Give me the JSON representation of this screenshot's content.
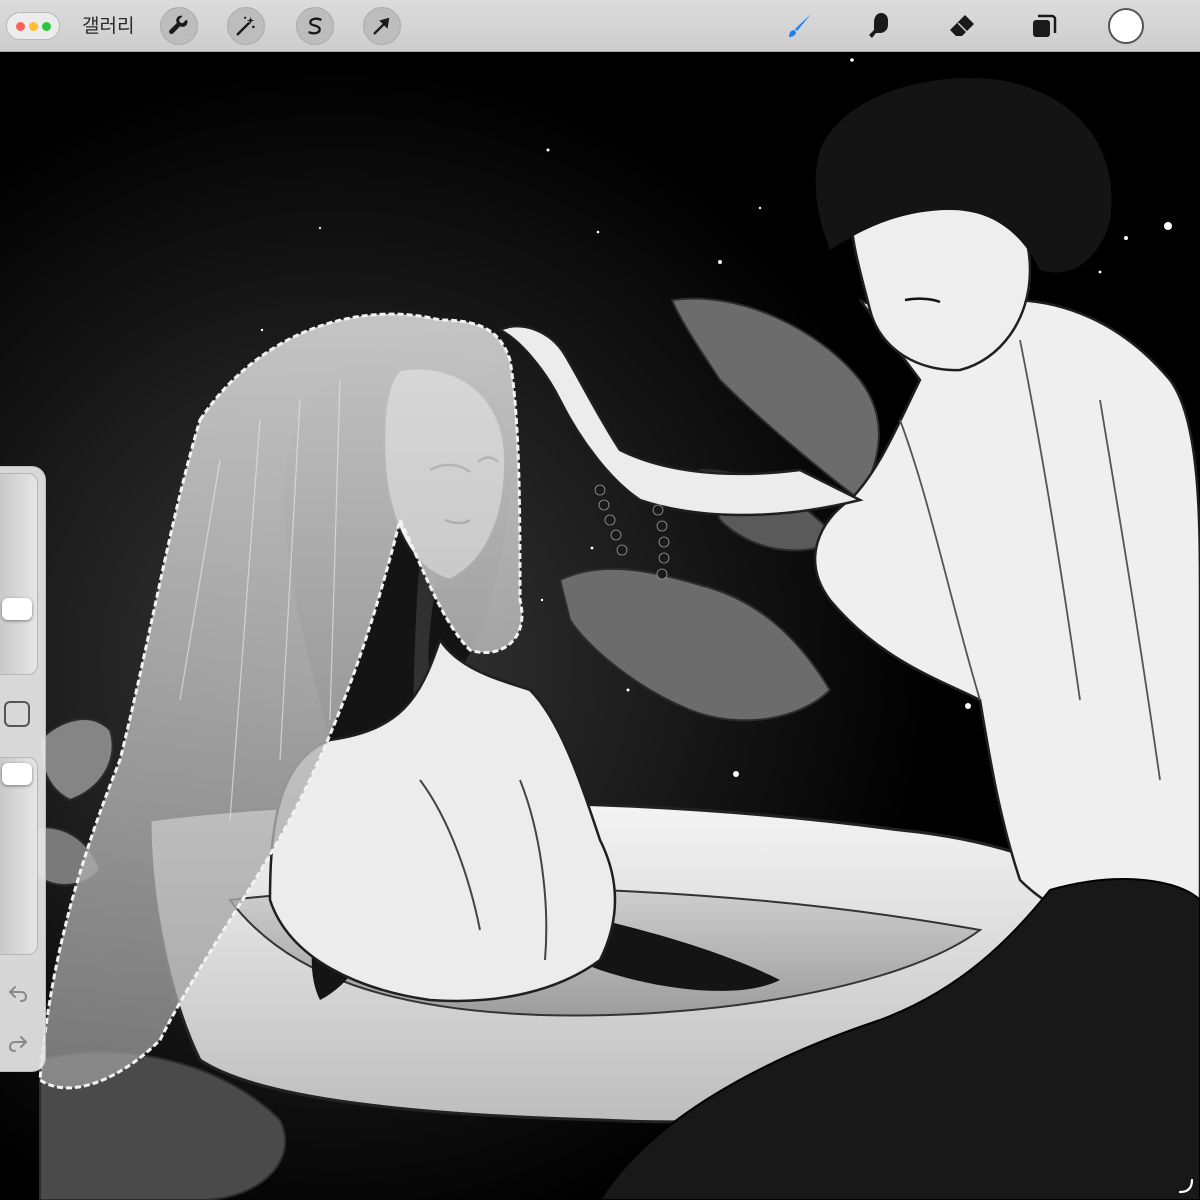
{
  "app": {
    "gallery_label": "갤러리"
  },
  "toolbar": {
    "left_tools": [
      {
        "name": "actions",
        "icon": "wrench-icon"
      },
      {
        "name": "adjustments",
        "icon": "magic-wand-icon"
      },
      {
        "name": "selection",
        "icon": "selection-s-icon"
      },
      {
        "name": "transform",
        "icon": "arrow-cursor-icon"
      }
    ],
    "right_tools": [
      {
        "name": "brush",
        "icon": "brush-icon",
        "active": true
      },
      {
        "name": "smudge",
        "icon": "smudge-finger-icon",
        "active": false
      },
      {
        "name": "eraser",
        "icon": "eraser-icon",
        "active": false
      },
      {
        "name": "layers",
        "icon": "layers-icon",
        "active": false
      }
    ],
    "current_color": "#ffffff"
  },
  "sidebar": {
    "brush_size_level": 0.3,
    "opacity_level": 0.98
  },
  "colors": {
    "toolbar_bg": "#d5d5d5",
    "active_tool": "#1e7ff0",
    "inactive_tool": "#1a1a1a",
    "close_dot": "#ff5f57",
    "minimize_dot": "#febc2e",
    "zoom_dot": "#28c840"
  }
}
